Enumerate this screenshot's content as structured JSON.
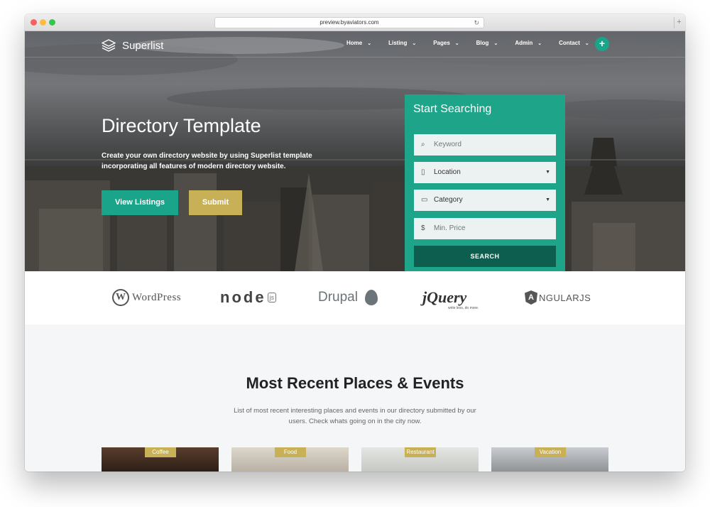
{
  "browser": {
    "url": "preview.byaviators.com"
  },
  "brand": {
    "name": "Superlist"
  },
  "nav": {
    "items": [
      {
        "label": "Home"
      },
      {
        "label": "Listing"
      },
      {
        "label": "Pages"
      },
      {
        "label": "Blog"
      },
      {
        "label": "Admin"
      },
      {
        "label": "Contact"
      }
    ],
    "plus": "+"
  },
  "hero": {
    "title": "Directory Template",
    "subtitle": "Create your own directory website by using Superlist template incorporating all features of modern directory website.",
    "primary_button": "View Listings",
    "secondary_button": "Submit"
  },
  "search": {
    "title": "Start Searching",
    "keyword_placeholder": "Keyword",
    "location_value": "Location",
    "category_value": "Category",
    "price_placeholder": "Min. Price",
    "price_icon": "$",
    "button": "SEARCH"
  },
  "logos": {
    "wordpress": "WordPress",
    "node": "node",
    "node_badge": "js",
    "drupal": "Drupal",
    "jquery": "jQuery",
    "jquery_tag": "write less, do more.",
    "angular": "NGULARJS"
  },
  "section": {
    "title": "Most Recent Places & Events",
    "description": "List of most recent interesting places and events in our directory submitted by our users. Check whats going on in the city now."
  },
  "cards": [
    {
      "category": "Coffee"
    },
    {
      "category": "Food"
    },
    {
      "category": "Restaurant"
    },
    {
      "category": "Vacation"
    }
  ],
  "colors": {
    "accent": "#1aa58a",
    "gold": "#c8b057",
    "dark_green": "#0d5e4e"
  }
}
